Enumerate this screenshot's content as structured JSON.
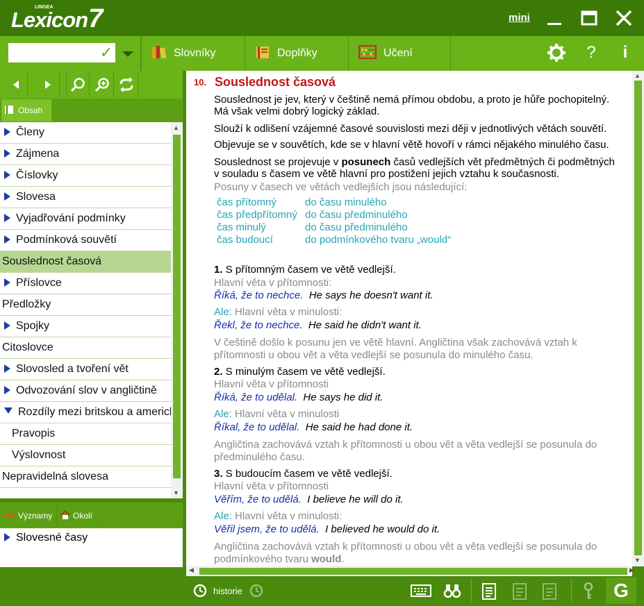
{
  "app": {
    "brand": "Lexicon",
    "brand_number": "7",
    "brand_small": "LINGEA",
    "mini_label": "mini"
  },
  "toolbar": {
    "search_value": "",
    "tabs": [
      {
        "label": "Slovníky",
        "icon": "books-icon"
      },
      {
        "label": "Doplňky",
        "icon": "book-icon"
      },
      {
        "label": "Učení",
        "icon": "abacus-icon"
      }
    ]
  },
  "left": {
    "obsah_label": "Obsah",
    "items": [
      {
        "label": "Členy",
        "arrow": "right"
      },
      {
        "label": "Zájmena",
        "arrow": "right"
      },
      {
        "label": "Číslovky",
        "arrow": "right"
      },
      {
        "label": "Slovesa",
        "arrow": "right"
      },
      {
        "label": "Vyjadřování podmínky",
        "arrow": "right"
      },
      {
        "label": "Podmínková souvětí",
        "arrow": "right"
      },
      {
        "label": "Souslednost časová",
        "arrow": "none",
        "selected": true
      },
      {
        "label": "Příslovce",
        "arrow": "right"
      },
      {
        "label": "Předložky",
        "arrow": "none"
      },
      {
        "label": "Spojky",
        "arrow": "right"
      },
      {
        "label": "Citoslovce",
        "arrow": "none"
      },
      {
        "label": "Slovosled a tvoření vět",
        "arrow": "right"
      },
      {
        "label": "Odvozování slov v angličtině",
        "arrow": "right"
      },
      {
        "label": "Rozdíly mezi britskou a americkou",
        "arrow": "down"
      },
      {
        "label": "Pravopis",
        "arrow": "indent"
      },
      {
        "label": "Výslovnost",
        "arrow": "indent"
      },
      {
        "label": "Nepravidelná slovesa",
        "arrow": "none"
      }
    ],
    "bottom_tabs": [
      {
        "label": "Významy"
      },
      {
        "label": "Okolí"
      }
    ],
    "bottom_item": "Slovesné časy"
  },
  "content": {
    "number": "10.",
    "title": "Souslednost časová",
    "p1a": "Souslednost je jev, který v češtině nemá přímou obdobu, a proto je hůře pochopitelný.",
    "p1b": "Má však velmi dobrý logický základ.",
    "p2": "Slouží k odlišení vzájemné časové souvislosti mezi ději v jednotlivých větách souvětí.",
    "p3": "Objevuje se v souvětích, kde se v hlavní větě hovoří v rámci nějakého minulého času.",
    "p4a_pre": "Souslednost se projevuje v ",
    "p4a_bold": "posunech",
    "p4a_post": " časů vedlejších vět předmětných či podmětných",
    "p4b": "v souladu s časem ve větě hlavní pro postižení jejich vztahu k současnosti.",
    "p5": "Posuny v časech ve větách vedlejších jsou následující:",
    "table": [
      [
        "čas přítomný",
        "do času minulého"
      ],
      [
        "čas předpřítomný",
        "do času předminulého"
      ],
      [
        "čas minulý",
        "do času předminulého"
      ],
      [
        "čas budoucí",
        "do podmínkového tvaru „would“"
      ]
    ],
    "s1_num": "1.",
    "s1_title": " S přítomným časem ve větě vedlejší.",
    "s1_l1": "Hlavní věta v přítomnosti:",
    "s1_cz1": "Říká, že to nechce.",
    "s1_en1": "He says he doesn't want it.",
    "ale": "Ale:",
    "main_past": " Hlavní věta v minulosti:",
    "s1_cz2": "Řekl, že to nechce.",
    "s1_en2": "He said he didn't want it.",
    "s1_note_a": "V češtině došlo k posunu jen ve větě hlavní. Angličtina však zachovává vztah k",
    "s1_note_b": "přítomnosti u obou vět a věta vedlejší se posunula do minulého času.",
    "s2_num": "2.",
    "s2_title": " S minulým časem ve větě vedlejší.",
    "s2_l1": "Hlavní věta v přítomnosti",
    "s2_cz1": "Říká, že to udělal.",
    "s2_en1": "He says he did it.",
    "main_past2": " Hlavní věta v minulosti",
    "s2_cz2": "Říkal, že to udělal.",
    "s2_en2": "He said he had done it.",
    "s2_note_a": "Angličtina zachovává vztah k přítomnosti u obou vět a věta vedlejší se posunula do",
    "s2_note_b": "předminulého času.",
    "s3_num": "3.",
    "s3_title": " S budoucím časem ve větě vedlejší.",
    "s3_l1": "Hlavní věta v přítomnosti",
    "s3_cz1": "Věřím, že to udělá.",
    "s3_en1": "I believe he will do it.",
    "s3_main_past": " Hlavní věta v minulosti:",
    "s3_cz2": "Věřil jsem, že to udělá.",
    "s3_en2": "I believed he would do it.",
    "s3_note_a": "Angličtina zachovává vztah k přítomnosti u obou vět a věta vedlejší se posunula do",
    "s3_note_b_pre": "podmínkového tvaru ",
    "s3_note_b_bold": "would",
    "s3_note_b_post": "."
  },
  "status": {
    "history_label": "historie",
    "g_label": "G"
  },
  "colors": {
    "dark_green": "#3c7a08",
    "toolbar_green": "#6ab41a",
    "title_red": "#c01818",
    "teal": "#2aa3b5",
    "example_blue": "#1a2ca8"
  }
}
